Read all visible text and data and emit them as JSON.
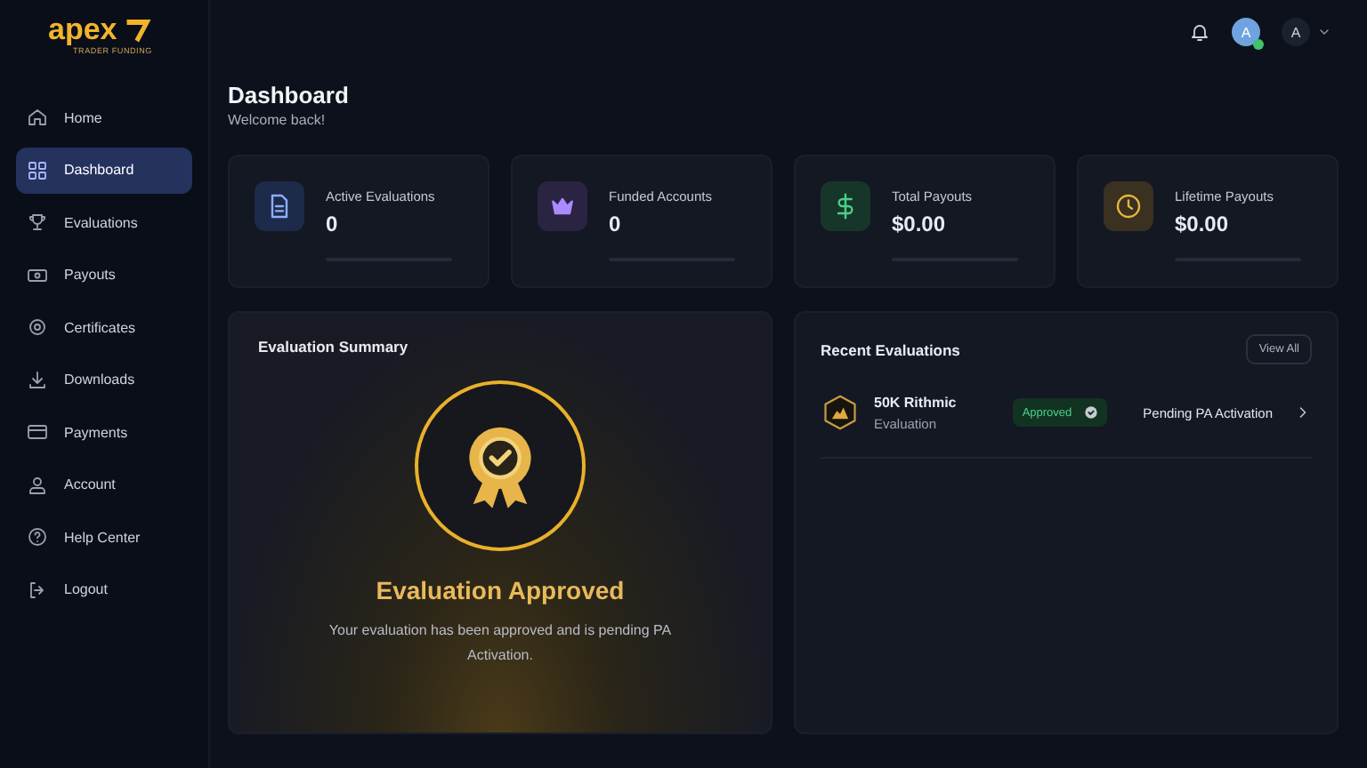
{
  "brand": {
    "name": "apex",
    "tagline": "TRADER FUNDING"
  },
  "topbar": {
    "avatar_initial": "A",
    "account_initial": "A"
  },
  "sidebar": {
    "items": [
      {
        "label": "Home",
        "selected": false
      },
      {
        "label": "Dashboard",
        "selected": true
      },
      {
        "label": "Evaluations",
        "selected": false
      },
      {
        "label": "Payouts",
        "selected": false
      },
      {
        "label": "Certificates",
        "selected": false
      },
      {
        "label": "Downloads",
        "selected": false
      },
      {
        "label": "Payments",
        "selected": false
      },
      {
        "label": "Account",
        "selected": false
      },
      {
        "label": "Help Center",
        "selected": false
      },
      {
        "label": "Logout",
        "selected": false
      }
    ]
  },
  "header": {
    "title": "Dashboard",
    "subtitle": "Welcome back!"
  },
  "stats": [
    {
      "label": "Active Evaluations",
      "value": "0"
    },
    {
      "label": "Funded Accounts",
      "value": "0"
    },
    {
      "label": "Total Payouts",
      "value": "$0.00"
    },
    {
      "label": "Lifetime Payouts",
      "value": "$0.00"
    }
  ],
  "evaluation_summary": {
    "title": "Evaluation Summary",
    "heading": "Evaluation Approved",
    "message": "Your evaluation has been approved and is pending PA Activation."
  },
  "recent_evaluations": {
    "title": "Recent Evaluations",
    "action": "View All",
    "rows": [
      {
        "name": "50K Rithmic",
        "type": "Evaluation",
        "badge": "Approved",
        "status": "Pending PA Activation"
      }
    ]
  }
}
